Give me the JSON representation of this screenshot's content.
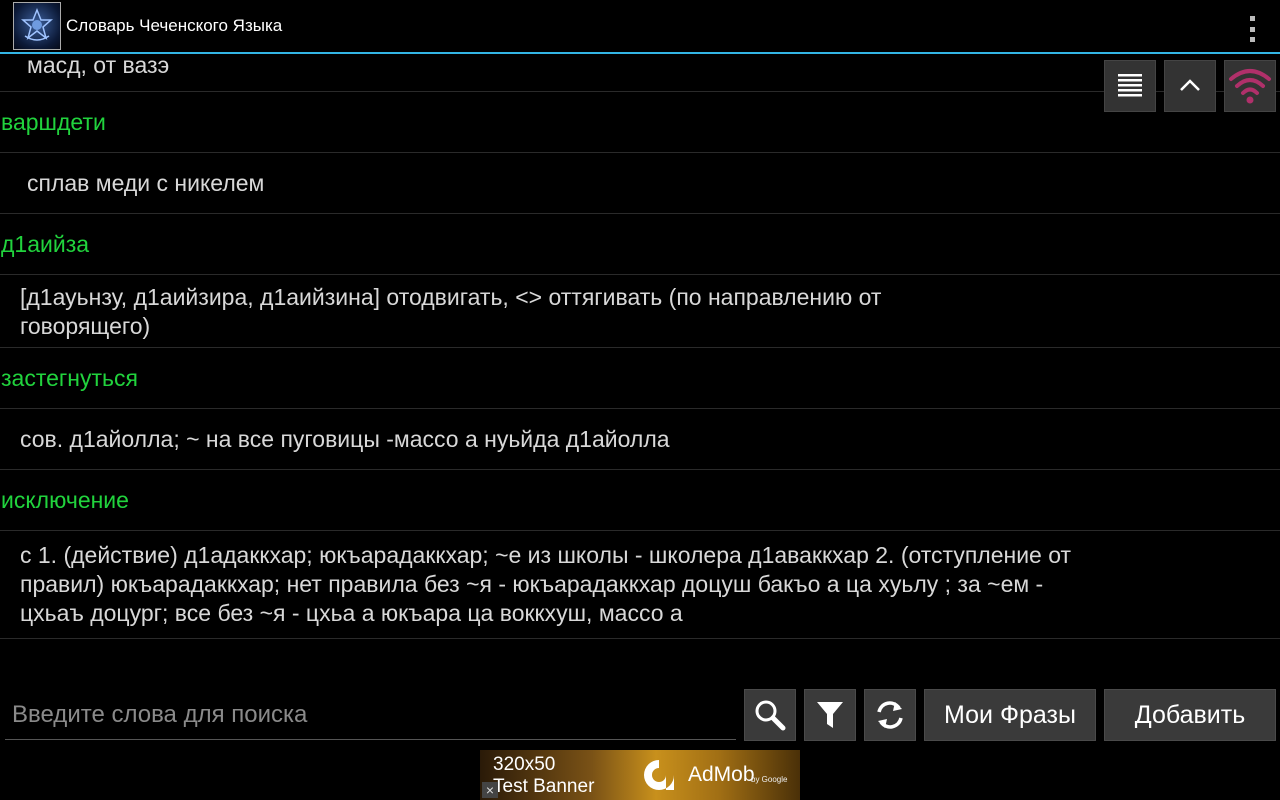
{
  "app": {
    "title": "Словарь Чеченского Языка"
  },
  "entries": [
    {
      "type": "partial",
      "text": "масд, от вазэ"
    },
    {
      "type": "word",
      "text": "варшдети"
    },
    {
      "type": "def",
      "text": "сплав меди с никелем"
    },
    {
      "type": "word",
      "text": "д1аийза"
    },
    {
      "type": "def",
      "text": "[д1ауьнзу, д1аийзира, д1аийзина] отодвигать, <> оттягивать (по направлению от говорящего)"
    },
    {
      "type": "word",
      "text": "застегнуться"
    },
    {
      "type": "def",
      "text": "сов. д1айолла; ~ на все пуговицы -массо а нуьйда д1айолла"
    },
    {
      "type": "word",
      "text": "исключение"
    },
    {
      "type": "def",
      "text": "с 1. (действие) д1адаккхар; юкъарадаккхар; ~е из школы - школера д1аваккхар 2. (отступление от правил) юкъарадаккхар; нет правила без ~я - юкъарадаккхар доцуш бакъо а ца хуьлу ; за ~ем - цхьаъ доцург; все без ~я - цхьа а юкъара ца воккхуш, массо а"
    }
  ],
  "floating_buttons": [
    {
      "name": "list-icon"
    },
    {
      "name": "chevron-up-icon"
    },
    {
      "name": "wifi-icon"
    }
  ],
  "toolbar": {
    "search_placeholder": "Введите слова для поиска",
    "search_value": "",
    "my_phrases_label": "Мои Фразы",
    "add_label": "Добавить"
  },
  "ad": {
    "size_text": "320x50",
    "label": "Test Banner",
    "brand": "AdMob",
    "by": "by Google",
    "close": "×"
  },
  "colors": {
    "accent": "#33b5e5",
    "word": "#21d33d",
    "wifi": "#b0306a"
  }
}
